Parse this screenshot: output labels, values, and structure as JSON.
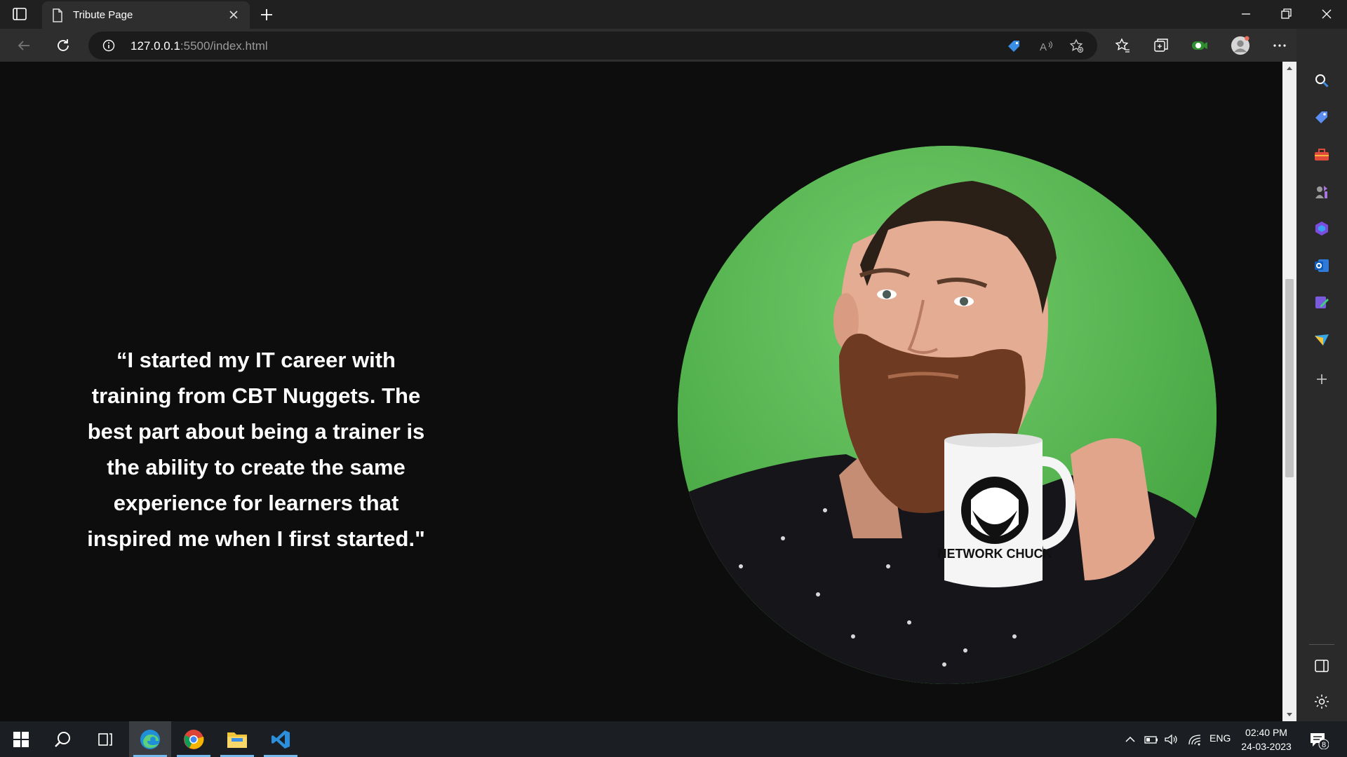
{
  "browser": {
    "tab_title": "Tribute Page",
    "url_host": "127.0.0.1",
    "url_rest": ":5500/index.html"
  },
  "page": {
    "quote": "“I started my IT career with training from CBT Nuggets. The best part about being a trainer is the ability to create the same experience for learners that inspired me when I first started.\"",
    "mug_text": "NETWORK CHUCK"
  },
  "taskbar": {
    "language": "ENG",
    "time": "02:40 PM",
    "date": "24-03-2023",
    "notifications": "8"
  },
  "colors": {
    "page_background": "#0d0d0d",
    "portrait_background": "#57b956",
    "text": "#ffffff",
    "taskbar_accent": "#76b9ed"
  }
}
